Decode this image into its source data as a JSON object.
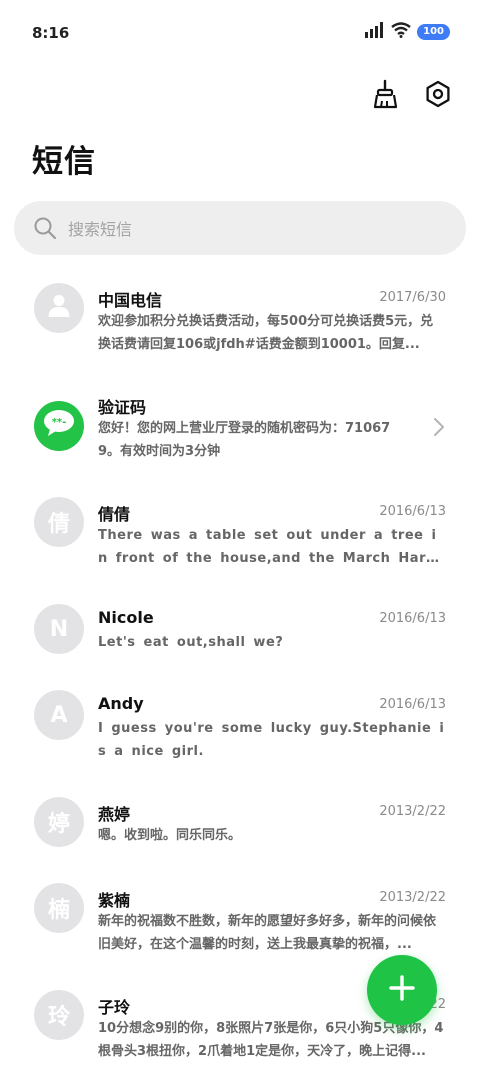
{
  "status_bar": {
    "time": "8:16",
    "battery": "100",
    "icons": [
      "signal-icon",
      "wifi-icon",
      "battery-icon"
    ]
  },
  "toolbar": {
    "icons": [
      "broom-icon",
      "settings-icon"
    ]
  },
  "page_title": "短信",
  "search": {
    "placeholder": "搜索短信"
  },
  "conversations": [
    {
      "avatar_text": "",
      "avatar_type": "person-icon",
      "name": "中国电信",
      "date": "2017/6/30",
      "preview": "欢迎参加积分兑换话费活动，每500分可兑换话费5元，兑换话费请回复106或jfdh#话费金额到10001。回复..."
    },
    {
      "avatar_text": "",
      "avatar_type": "message-bubble-icon",
      "name": "验证码",
      "date": "",
      "preview": "您好！您的网上营业厅登录的随机密码为：710679。有效时间为3分钟"
    },
    {
      "avatar_text": "倩",
      "name": "倩倩",
      "date": "2016/6/13",
      "preview": "There was a table set out under a tree in front of the house,and the March Hare and the Hatt..."
    },
    {
      "avatar_text": "N",
      "name": "Nicole",
      "date": "2016/6/13",
      "preview": "Let's eat out,shall we?"
    },
    {
      "avatar_text": "A",
      "name": "Andy",
      "date": "2016/6/13",
      "preview": "I guess you're some lucky guy.Stephanie is a nice girl."
    },
    {
      "avatar_text": "婷",
      "name": "燕婷",
      "date": "2013/2/22",
      "preview": "嗯。收到啦。同乐同乐。"
    },
    {
      "avatar_text": "楠",
      "name": "紫楠",
      "date": "2013/2/22",
      "preview": "新年的祝福数不胜数，新年的愿望好多好多，新年的问候依旧美好，在这个温馨的时刻，送上我最真挚的祝福，..."
    },
    {
      "avatar_text": "玲",
      "name": "子玲",
      "date": "2013/2/22",
      "preview": "10分想念9别的你，8张照片7张是你，6只小狗5只像你，4根骨头3根扭你，2爪着地1定是你，天冷了，晚上记得..."
    }
  ],
  "fab": {
    "icon": "plus-icon"
  },
  "colors": {
    "accent": "#1fc346",
    "battery_badge": "#3e7bf6",
    "avatar_bg": "#e3e3e6"
  }
}
